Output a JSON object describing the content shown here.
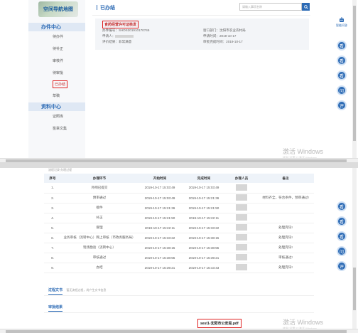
{
  "colors": {
    "accent": "#2d6bb5",
    "highlight": "#e02020",
    "sidebar_bg": "#f7f8fa"
  },
  "sidebar": {
    "logo": "空间导航地图",
    "section1": "办件中心",
    "items": [
      "待办件",
      "待补正",
      "审核件",
      "待审批",
      "已办结",
      "草稿"
    ],
    "section2": "资料中心",
    "items2": [
      "证照库",
      "签章文集"
    ]
  },
  "page": {
    "title": "已办结",
    "search_placeholder": "请输入事项名称"
  },
  "case": {
    "title": "食药经营许可证核发",
    "kv": [
      {
        "label": "办件编号：",
        "value": "SHDS201910170746"
      },
      {
        "label": "申请人：",
        "value": ""
      },
      {
        "label": "评价结果：",
        "value": "非常满意"
      },
      {
        "label": "窗口部门：",
        "value": "沈阳市农业农村局"
      },
      {
        "label": "申请时间：",
        "value": "2019-10-17"
      },
      {
        "label": "审批完成时间：",
        "value": "2019-10-17"
      }
    ]
  },
  "dock": {
    "head": "智能问答",
    "buttons": [
      "看",
      "看",
      "看",
      "问",
      "评"
    ]
  },
  "watermark": {
    "text": "激活 Windows",
    "sub": "转到\"设置\"以激活 Windows。"
  },
  "table": {
    "top_tabs": "流程记录  办理过程",
    "headers": [
      "序号",
      "办理环节",
      "开始时间",
      "完成时间",
      "办理人员",
      "备注"
    ],
    "rows": [
      {
        "no": "1.",
        "step": "外网已提交",
        "start": "2019-10-17 15:03:49",
        "end": "2019-10-17 15:03:49",
        "note": ""
      },
      {
        "no": "2.",
        "step": "预审通过",
        "start": "2019-10-17 15:03:49",
        "end": "2019-10-17 15:21:36",
        "note": "材料齐全，符合条件，预审通过!"
      },
      {
        "no": "3.",
        "step": "接件",
        "start": "2019-10-17 15:21:36",
        "end": "2019-10-17 15:21:50",
        "note": ""
      },
      {
        "no": "4.",
        "step": "补正",
        "start": "2019-10-17 15:21:50",
        "end": "2019-10-17 15:22:11",
        "note": ""
      },
      {
        "no": "5.",
        "step": "受理",
        "start": "2019-10-17 15:22:11",
        "end": "2019-10-17 15:33:22",
        "note": "处理完毕!"
      },
      {
        "no": "6.",
        "step": "业务审核（流转中心）网上审核（市政务服务局）",
        "start": "2019-10-17 15:33:22",
        "end": "2019-10-17 15:38:15",
        "note": "处理完毕!"
      },
      {
        "no": "7.",
        "step": "现场勘验（流转中心）",
        "start": "2019-10-17 15:38:15",
        "end": "2019-10-17 15:38:55",
        "note": "处理完毕!"
      },
      {
        "no": "8.",
        "step": "审核通过",
        "start": "2019-10-17 15:38:55",
        "end": "2019-10-17 15:39:21",
        "note": "审核通过!"
      },
      {
        "no": "9.",
        "step": "办结",
        "start": "2019-10-17 15:39:21",
        "end": "2019-10-17 15:43:43",
        "note": "处理完毕!"
      }
    ]
  },
  "docs": {
    "tab": "过程文书",
    "hint": "暂无流程过程，尚产生文书信息",
    "result_tab": "审批结果",
    "file": "sest1-沈阳市公安局.pdf"
  }
}
